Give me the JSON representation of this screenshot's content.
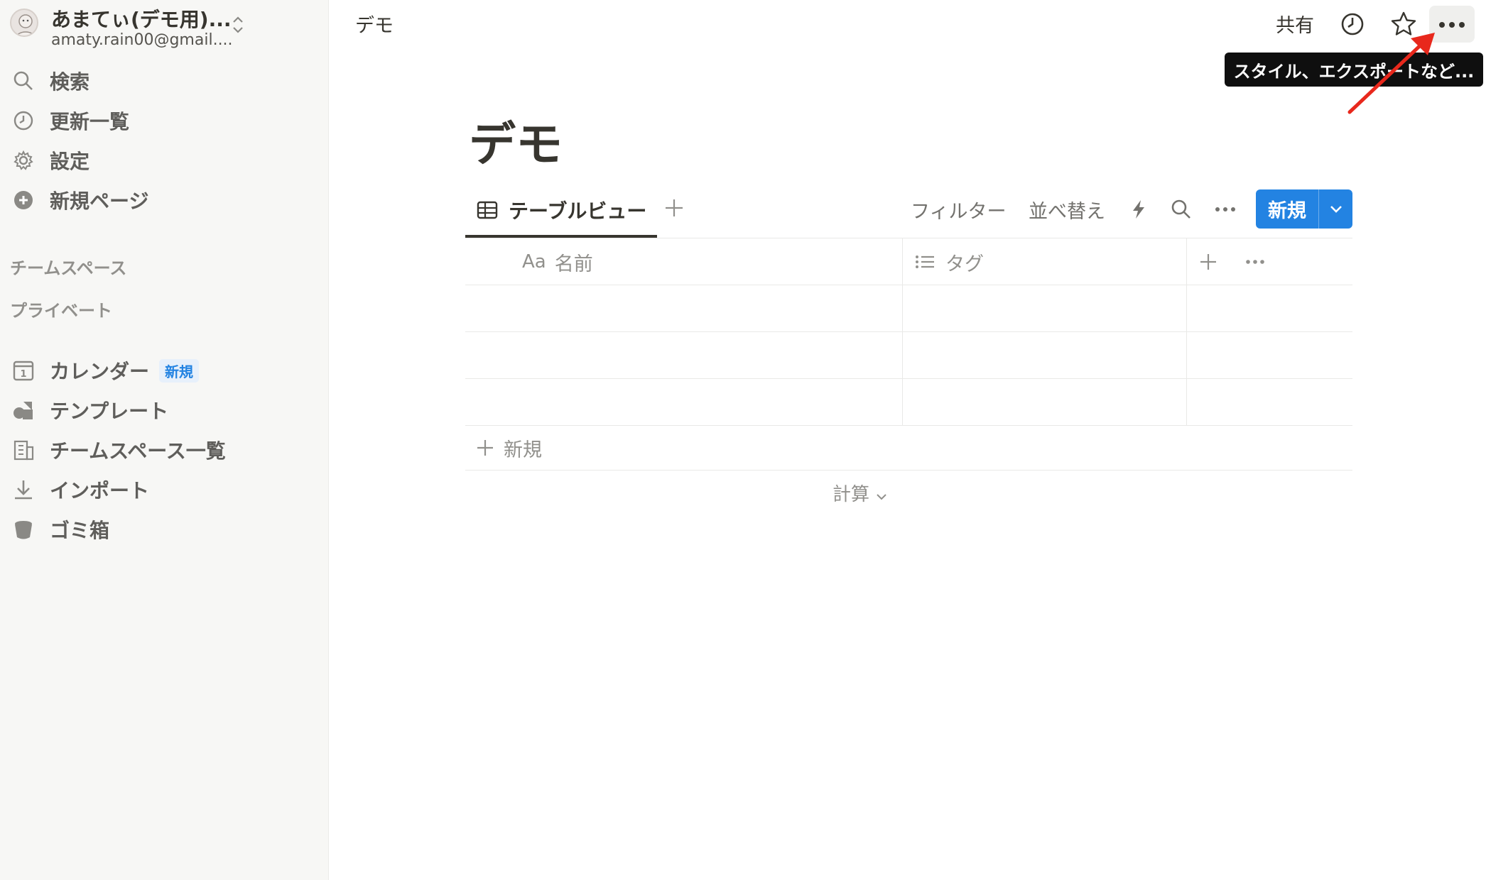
{
  "sidebar": {
    "workspace": {
      "name": "あまてぃ(デモ用)...",
      "email": "amaty.rain00@gmail...."
    },
    "nav": [
      {
        "label": "検索",
        "icon": "search-icon"
      },
      {
        "label": "更新一覧",
        "icon": "clock-icon"
      },
      {
        "label": "設定",
        "icon": "gear-icon"
      },
      {
        "label": "新規ページ",
        "icon": "plus-circle-icon"
      }
    ],
    "sections": {
      "teamspace": "チームスペース",
      "private": "プライベート"
    },
    "bottom": [
      {
        "label": "カレンダー",
        "icon": "calendar-icon",
        "badge": "新規"
      },
      {
        "label": "テンプレート",
        "icon": "shapes-icon"
      },
      {
        "label": "チームスペース一覧",
        "icon": "building-icon"
      },
      {
        "label": "インポート",
        "icon": "download-icon"
      },
      {
        "label": "ゴミ箱",
        "icon": "trash-icon"
      }
    ]
  },
  "topbar": {
    "breadcrumb": "デモ",
    "share": "共有",
    "tooltip": "スタイル、エクスポートなど..."
  },
  "page": {
    "title": "デモ",
    "view_tab": "テーブルビュー",
    "toolbar": {
      "filter": "フィルター",
      "sort": "並べ替え",
      "new": "新規"
    },
    "table": {
      "columns": [
        {
          "prefix": "Aa",
          "label": "名前"
        },
        {
          "label": "タグ"
        }
      ],
      "rows": [
        [
          "",
          ""
        ],
        [
          "",
          ""
        ],
        [
          "",
          ""
        ]
      ],
      "add_row": "新規",
      "calc": "計算"
    }
  },
  "colors": {
    "accent": "#2383e2",
    "annotation_arrow": "#e8281c"
  }
}
